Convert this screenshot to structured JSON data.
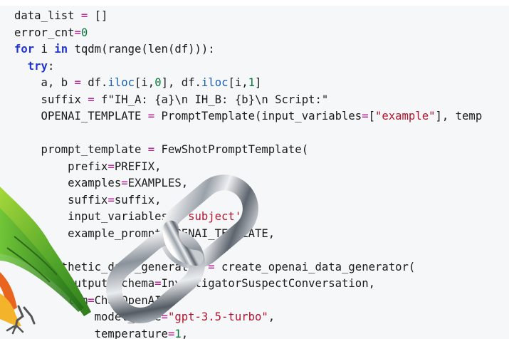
{
  "code": {
    "lines": [
      [
        {
          "t": "data_list "
        },
        {
          "t": "=",
          "c": "op"
        },
        {
          "t": " []"
        }
      ],
      [
        {
          "t": "error_cnt"
        },
        {
          "t": "=",
          "c": "op"
        },
        {
          "t": "0",
          "c": "num"
        }
      ],
      [
        {
          "t": "for",
          "c": "kw"
        },
        {
          "t": " i "
        },
        {
          "t": "in",
          "c": "kw"
        },
        {
          "t": " tqdm(range(len(df))):"
        }
      ],
      [
        {
          "t": "  "
        },
        {
          "t": "try",
          "c": "kw"
        },
        {
          "t": ":"
        }
      ],
      [
        {
          "t": "    a, b "
        },
        {
          "t": "=",
          "c": "op"
        },
        {
          "t": " df."
        },
        {
          "t": "iloc",
          "c": "meth"
        },
        {
          "t": "[i,"
        },
        {
          "t": "0",
          "c": "num"
        },
        {
          "t": "], df."
        },
        {
          "t": "iloc",
          "c": "meth"
        },
        {
          "t": "[i,"
        },
        {
          "t": "1",
          "c": "num"
        },
        {
          "t": "]"
        }
      ],
      [
        {
          "t": "    suffix "
        },
        {
          "t": "=",
          "c": "op"
        },
        {
          "t": " f\"IH_A: {a}\\n IH_B: {b}\\n Script:\""
        }
      ],
      [
        {
          "t": "    OPENAI_TEMPLATE "
        },
        {
          "t": "=",
          "c": "op"
        },
        {
          "t": " PromptTemplate(input_variables"
        },
        {
          "t": "=",
          "c": "op"
        },
        {
          "t": "["
        },
        {
          "t": "\"example\"",
          "c": "str"
        },
        {
          "t": "], temp"
        }
      ],
      [
        {
          "t": ""
        }
      ],
      [
        {
          "t": "    prompt_template "
        },
        {
          "t": "=",
          "c": "op"
        },
        {
          "t": " FewShotPromptTemplate("
        }
      ],
      [
        {
          "t": "        prefix"
        },
        {
          "t": "=",
          "c": "op"
        },
        {
          "t": "PREFIX,"
        }
      ],
      [
        {
          "t": "        examples"
        },
        {
          "t": "=",
          "c": "op"
        },
        {
          "t": "EXAMPLES,"
        }
      ],
      [
        {
          "t": "        suffix"
        },
        {
          "t": "=",
          "c": "op"
        },
        {
          "t": "suffix,"
        }
      ],
      [
        {
          "t": "        input_variables"
        },
        {
          "t": "=",
          "c": "op"
        },
        {
          "t": "["
        },
        {
          "t": "'subject'",
          "c": "str"
        },
        {
          "t": "],"
        }
      ],
      [
        {
          "t": "        example_prompt"
        },
        {
          "t": "=",
          "c": "op"
        },
        {
          "t": "OPENAI_TEMPLATE,"
        }
      ],
      [
        {
          "t": "    )"
        }
      ],
      [
        {
          "t": "    synthetic_data_generator "
        },
        {
          "t": "=",
          "c": "op"
        },
        {
          "t": " create_openai_data_generator("
        }
      ],
      [
        {
          "t": "        output_schema"
        },
        {
          "t": "=",
          "c": "op"
        },
        {
          "t": "InvestigatorSuspectConversation,"
        }
      ],
      [
        {
          "t": "        llm"
        },
        {
          "t": "=",
          "c": "op"
        },
        {
          "t": "ChatOpenAI("
        }
      ],
      [
        {
          "t": "            model_name"
        },
        {
          "t": "=",
          "c": "op"
        },
        {
          "t": "\"gpt-3.5-turbo\"",
          "c": "str"
        },
        {
          "t": ","
        }
      ],
      [
        {
          "t": "            temperature"
        },
        {
          "t": "=",
          "c": "op"
        },
        {
          "t": "1",
          "c": "num"
        },
        {
          "t": ","
        }
      ]
    ]
  },
  "colors": {
    "keyword": "#1f34d6",
    "operator": "#b5178f",
    "number": "#0a7a3c",
    "string": "#b3122e",
    "method": "#1a5fb4"
  },
  "icons": {
    "overlay_1": "chain-link-icon",
    "overlay_2": "parrot-icon"
  }
}
